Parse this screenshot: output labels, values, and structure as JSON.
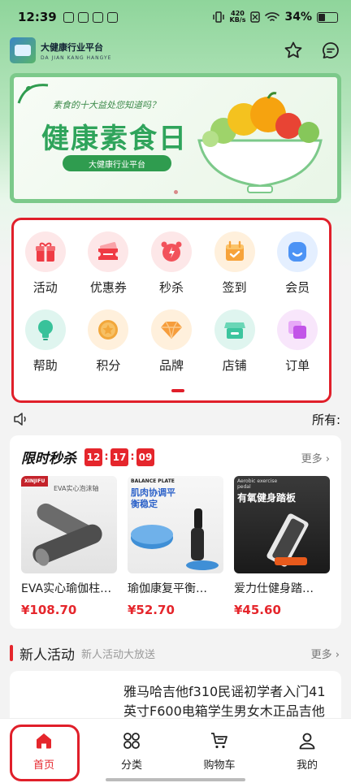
{
  "status_bar": {
    "time": "12:39",
    "net_speed": "420",
    "net_unit": "KB/s",
    "battery": "34%"
  },
  "header": {
    "title": "大健康行业平台",
    "subtitle": "DA JIAN KANG HANGYE"
  },
  "banner": {
    "question": "素食的十大益处您知道吗？",
    "title": "健康素食日",
    "pill": "大健康行业平台"
  },
  "quick_menu": [
    {
      "label": "活动",
      "icon": "gift-icon",
      "bg": "#fde7e8",
      "color": "#ef3b44"
    },
    {
      "label": "优惠券",
      "icon": "coupon-icon",
      "bg": "#fde7e8",
      "color": "#ef3b44"
    },
    {
      "label": "秒杀",
      "icon": "alarm-clock-icon",
      "bg": "#fde7e8",
      "color": "#f2525b"
    },
    {
      "label": "签到",
      "icon": "calendar-check-icon",
      "bg": "#fff0dc",
      "color": "#f7a33a"
    },
    {
      "label": "会员",
      "icon": "member-icon",
      "bg": "#e4efff",
      "color": "#4c93f5"
    },
    {
      "label": "帮助",
      "icon": "lightbulb-icon",
      "bg": "#dff5ef",
      "color": "#38c29a"
    },
    {
      "label": "积分",
      "icon": "points-star-icon",
      "bg": "#fff0dc",
      "color": "#f2a73b"
    },
    {
      "label": "品牌",
      "icon": "diamond-icon",
      "bg": "#fff0dc",
      "color": "#f69d3c"
    },
    {
      "label": "店铺",
      "icon": "store-icon",
      "bg": "#dff5ef",
      "color": "#3cc59e"
    },
    {
      "label": "订单",
      "icon": "order-icon",
      "bg": "#f8e6fb",
      "color": "#c255e8"
    }
  ],
  "notice": {
    "text": "所有:"
  },
  "flash_sale": {
    "title": "限时秒杀",
    "hours": "12",
    "minutes": "17",
    "seconds": "09",
    "sep": ":",
    "more": "更多",
    "products": [
      {
        "name": "EVA实心瑜伽柱…",
        "price": "¥108.70",
        "tag": "XINJIFU",
        "caption": "EVA实心泡沫轴"
      },
      {
        "name": "瑜伽康复平衡…",
        "price": "¥52.70",
        "tag": "BALANCE PLATE",
        "caption": "肌肉协调平衡稳定"
      },
      {
        "name": "爱力仕健身踏…",
        "price": "¥45.60",
        "tag": "Aerobic exercise pedal",
        "caption": "有氧健身踏板"
      }
    ]
  },
  "new_user": {
    "title": "新人活动",
    "subtitle": "新人活动大放送",
    "more": "更多",
    "item_desc": "雅马哈吉他f310民谣初学者入门41英寸F600电箱学生男女木正品吉他"
  },
  "bottom_nav": [
    {
      "label": "首页",
      "icon": "home-icon",
      "active": true
    },
    {
      "label": "分类",
      "icon": "category-icon",
      "active": false
    },
    {
      "label": "购物车",
      "icon": "cart-icon",
      "active": false
    },
    {
      "label": "我的",
      "icon": "user-icon",
      "active": false
    }
  ]
}
